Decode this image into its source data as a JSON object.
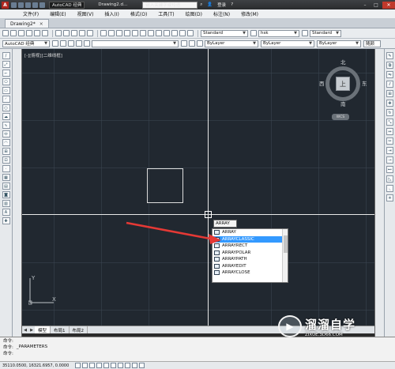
{
  "titlebar": {
    "workspace": "AutoCAD 经典",
    "doc_title": "Drawing2.d...",
    "search_placeholder": "键入关键字或短语",
    "login": "登录",
    "help": "?"
  },
  "menubar": {
    "items": [
      "文件(F)",
      "编辑(E)",
      "视图(V)",
      "插入(I)",
      "格式(O)",
      "工具(T)",
      "绘图(D)",
      "标注(N)",
      "修改(M)"
    ]
  },
  "tabs": [
    {
      "label": "Drawing2*",
      "close": "×"
    }
  ],
  "toolbar1": {
    "textstyle": "Standard",
    "dimstyle": "hsk",
    "tablestyle": "Standard"
  },
  "toolbar2": {
    "workspace": "AutoCAD 经典",
    "layer_color": "ByLayer",
    "layer_linetype": "ByLayer",
    "layer_lineweight": "ByLayer",
    "plot_style": "随颜"
  },
  "viewport": {
    "label": "[-][俯视][二维线框]"
  },
  "viewcube": {
    "north": "北",
    "south": "南",
    "east": "东",
    "west": "西",
    "top": "上",
    "wcs": "WCS"
  },
  "command_input": "ARRAY",
  "autocomplete": {
    "items": [
      "ARRAY",
      "ARRAYCLASSIC",
      "ARRAYRECT",
      "ARRAYPOLAR",
      "ARRAYPATH",
      "ARRAYEDIT",
      "ARRAYCLOSE"
    ],
    "selected_index": 1
  },
  "ucs": {
    "y": "Y",
    "x": "X"
  },
  "layout_tabs": [
    "模型",
    "布局1",
    "布局2"
  ],
  "cmdline": {
    "lines": [
      {
        "prompt": "命令:",
        "text": ""
      },
      {
        "prompt": "命令:",
        "text": "_PARAMETERS"
      },
      {
        "prompt": "命令:",
        "text": ""
      }
    ]
  },
  "status": {
    "coords": "35110.0500, 16321.6957, 0.0000"
  },
  "watermark": {
    "brand": "溜溜自学",
    "url": "ZIXUE.3D66.COM"
  },
  "colors": {
    "canvas": "#212830",
    "selection": "#3399ff",
    "arrow": "#e53935"
  }
}
